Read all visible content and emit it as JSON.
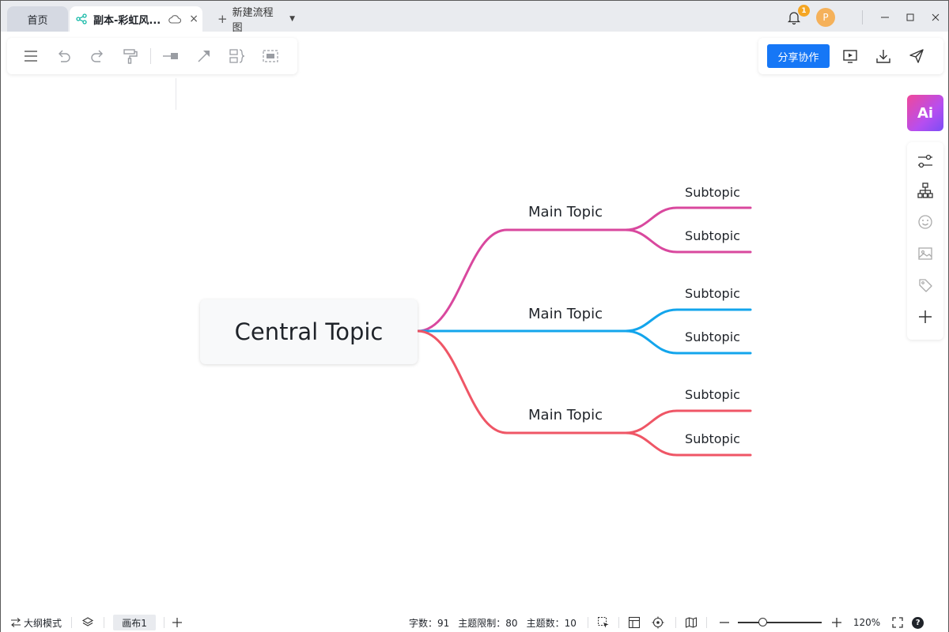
{
  "tabs": {
    "home": "首页",
    "doc": "副本-彩虹风...",
    "new": "新建流程图"
  },
  "window": {
    "notification_count": "1",
    "avatar_letter": "P"
  },
  "toolbar_right": {
    "share_label": "分享协作"
  },
  "ai_label": "Ai",
  "mindmap": {
    "central": "Central Topic",
    "branches": [
      {
        "label": "Main Topic",
        "color": "#d9489e",
        "subtopics": [
          "Subtopic",
          "Subtopic"
        ]
      },
      {
        "label": "Main Topic",
        "color": "#13a5ec",
        "subtopics": [
          "Subtopic",
          "Subtopic"
        ]
      },
      {
        "label": "Main Topic",
        "color": "#ef5666",
        "subtopics": [
          "Subtopic",
          "Subtopic"
        ]
      }
    ]
  },
  "statusbar": {
    "outline_mode": "大纲模式",
    "canvas_tab": "画布1",
    "word_count": "字数：91",
    "topic_limit": "主题限制：80",
    "topic_count": "主题数：10",
    "zoom": "120%",
    "help": "?"
  },
  "colors": {
    "accent": "#1677f6",
    "ai_gradient_start": "#f0489a",
    "ai_gradient_end": "#7b4df5"
  }
}
